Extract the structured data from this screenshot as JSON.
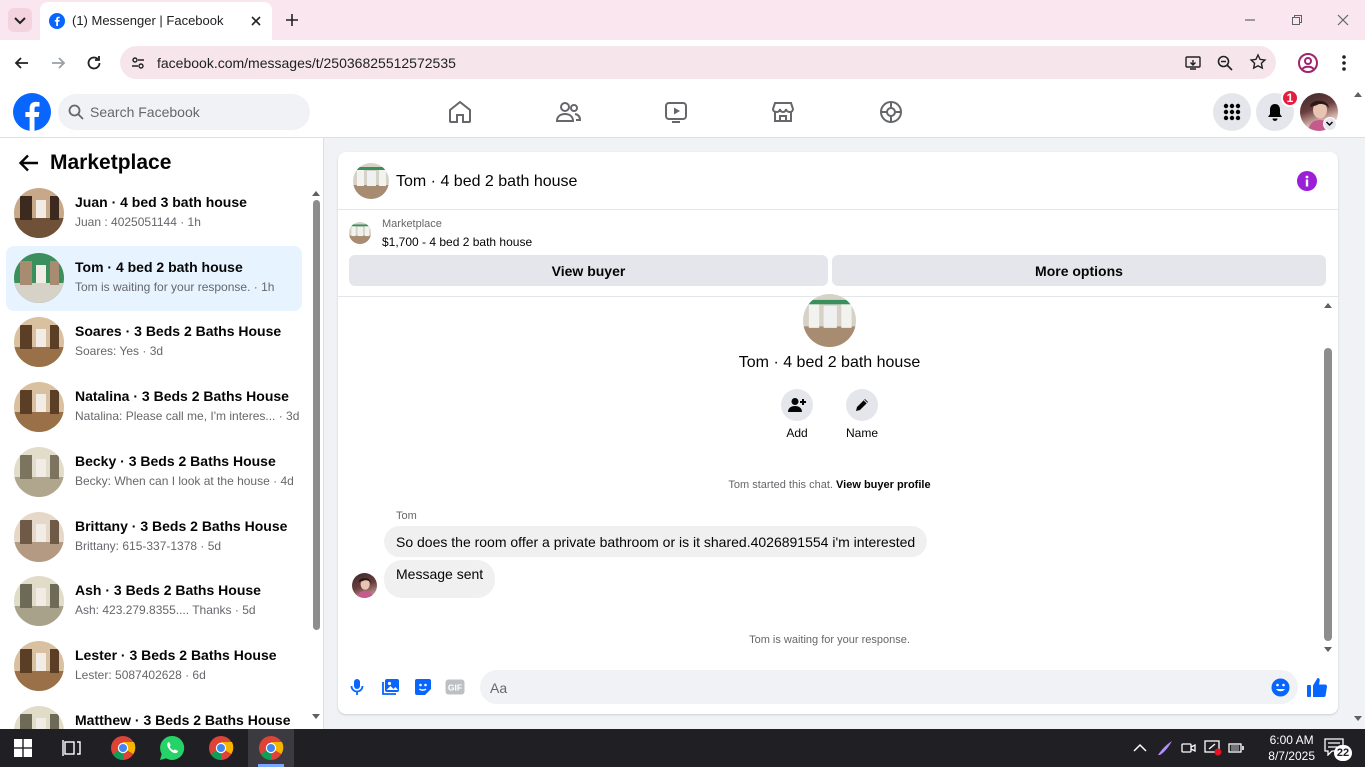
{
  "browser": {
    "tab_title": "(1) Messenger | Facebook",
    "url": "facebook.com/messages/t/25036825512572535"
  },
  "fb": {
    "search_placeholder": "Search Facebook",
    "notification_count": "1",
    "brand_color": "#0866ff"
  },
  "sidebar": {
    "title": "Marketplace",
    "conversations": [
      {
        "name": "Juan · 4 bed 3 bath house",
        "preview": "Juan : 4025051144 · 1h",
        "active": false
      },
      {
        "name": "Tom · 4 bed 2 bath house",
        "preview": "Tom is waiting for your response. · 1h",
        "active": true
      },
      {
        "name": "Soares · 3 Beds 2 Baths House",
        "preview": "Soares: Yes · 3d",
        "active": false
      },
      {
        "name": "Natalina · 3 Beds 2 Baths House",
        "preview": "Natalina: Please call me, I'm interes... · 3d",
        "active": false
      },
      {
        "name": "Becky · 3 Beds 2 Baths House",
        "preview": "Becky: When can I look at the house · 4d",
        "active": false
      },
      {
        "name": "Brittany · 3 Beds 2 Baths House",
        "preview": "Brittany: 615-337-1378 · 5d",
        "active": false
      },
      {
        "name": "Ash · 3 Beds 2 Baths House",
        "preview": "Ash: 423.279.8355.... Thanks · 5d",
        "active": false
      },
      {
        "name": "Lester · 3 Beds 2 Baths House",
        "preview": "Lester: 5087402628 · 6d",
        "active": false
      },
      {
        "name": "Matthew · 3 Beds 2 Baths House",
        "preview": "",
        "active": false
      }
    ]
  },
  "chat": {
    "title": "Tom · 4 bed 2 bath house",
    "listing_source": "Marketplace",
    "listing": "$1,700 - 4 bed 2 bath house",
    "view_buyer": "View buyer",
    "more_options": "More options",
    "profile_title": "Tom · 4 bed 2 bath house",
    "add_label": "Add",
    "name_label": "Name",
    "started_text": "Tom started this chat.",
    "view_buyer_profile": "View buyer profile",
    "sender": "Tom",
    "message_in": "So does the room offer a private bathroom or is it shared.4026891554 i'm interested",
    "message_out": "Message sent",
    "waiting": "Tom is waiting for your response.",
    "composer_placeholder": "Aa"
  },
  "taskbar": {
    "time": "6:00 AM",
    "date": "8/7/2025",
    "notif_count": "22"
  }
}
